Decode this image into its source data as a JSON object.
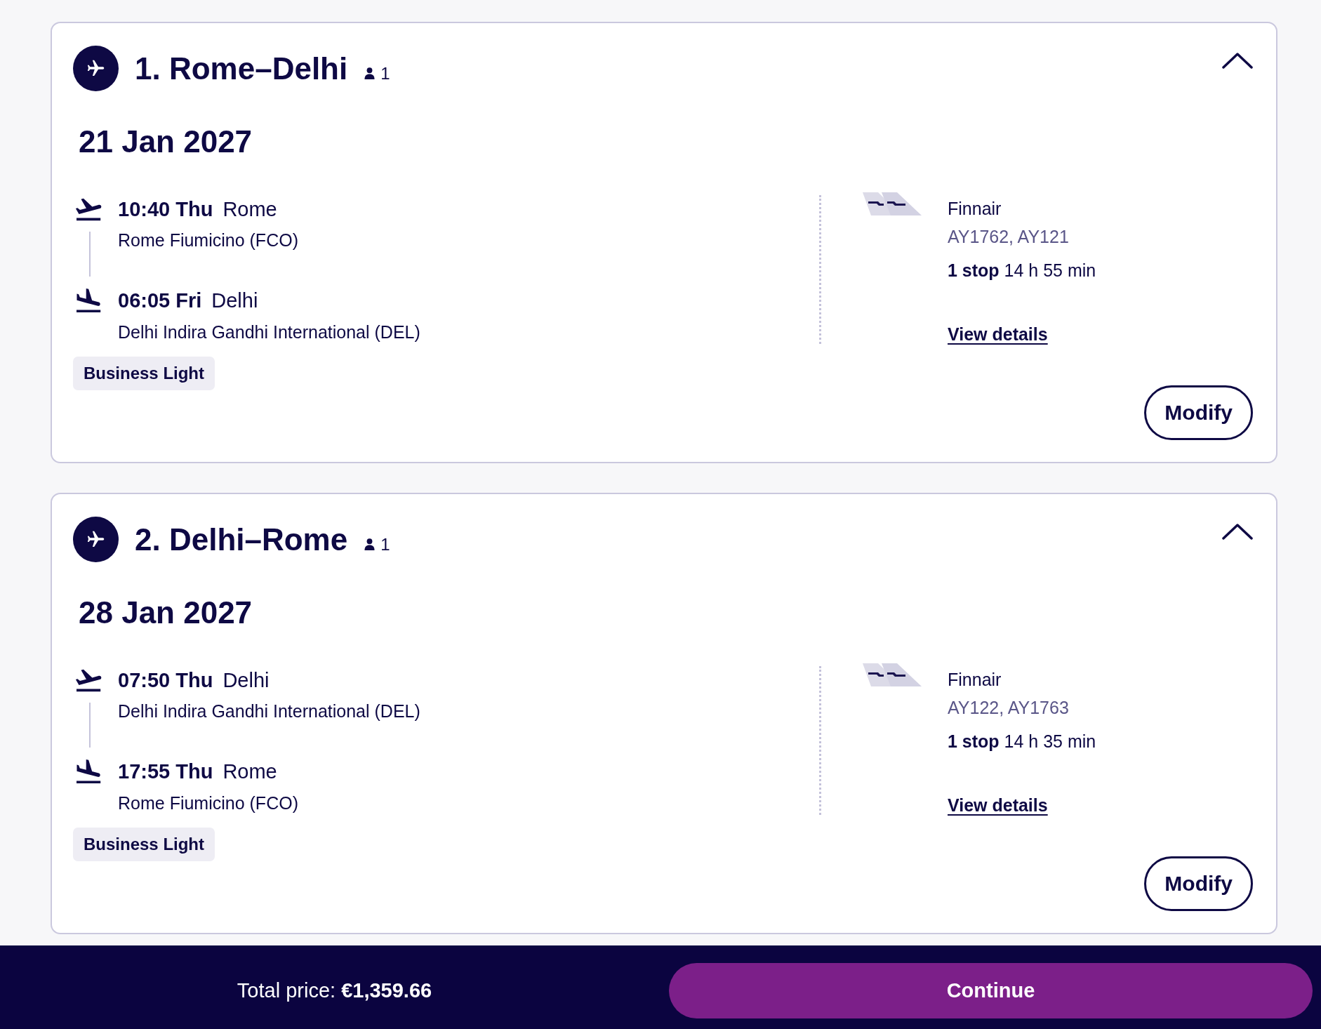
{
  "flights": [
    {
      "title": "1. Rome–Delhi",
      "passengers": "1",
      "expanded": true,
      "date": "21 Jan 2027",
      "departure": {
        "time": "10:40 Thu",
        "city": "Rome",
        "airport": "Rome Fiumicino (FCO)"
      },
      "arrival": {
        "time": "06:05 Fri",
        "city": "Delhi",
        "airport": "Delhi Indira Gandhi International (DEL)"
      },
      "fare": "Business Light",
      "airline": "Finnair",
      "flight_numbers": "AY1762, AY121",
      "stops": "**1 stop** 14 h 55 min",
      "details_link": "View details",
      "modify_button": "Modify"
    },
    {
      "title": "2. Delhi–Rome",
      "passengers": "1",
      "expanded": true,
      "date": "28 Jan 2027",
      "departure": {
        "time": "07:50 Thu",
        "city": "Delhi",
        "airport": "Delhi Indira Gandhi International (DEL)"
      },
      "arrival": {
        "time": "17:55 Thu",
        "city": "Rome",
        "airport": "Rome Fiumicino (FCO)"
      },
      "fare": "Business Light",
      "airline": "Finnair",
      "flight_numbers": "AY122, AY1763",
      "stops": "**1 stop** 14 h 35 min",
      "details_link": "View details",
      "modify_button": "Modify"
    }
  ],
  "footer": {
    "total_price": "Total price: **€1,359.66**",
    "continue_button": "Continue"
  }
}
